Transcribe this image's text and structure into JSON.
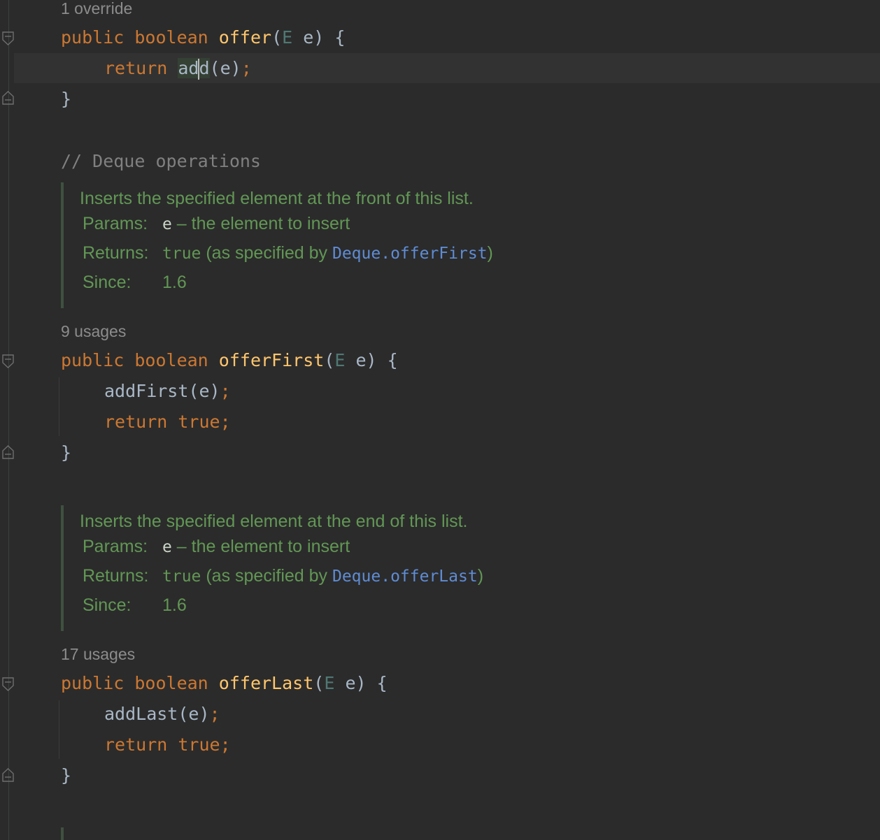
{
  "hints": {
    "override": "1 override",
    "usages_first": "9 usages",
    "usages_last": "17 usages"
  },
  "offer": {
    "kw_public": "public",
    "kw_boolean": "boolean",
    "name": "offer",
    "paren_open": "(",
    "type": "E",
    "param": " e) {",
    "kw_return": "return",
    "call_a": "ad",
    "call_b": "d",
    "call_args": "(e)",
    "semi": ";",
    "close": "}"
  },
  "comment": "// Deque operations",
  "doc_first": {
    "lead": "Inserts the specified element at the front of this list.",
    "params_label": "Params:",
    "params_name": "e",
    "params_desc": " – the element to insert",
    "returns_label": "Returns:",
    "returns_code": "true",
    "returns_text": " (as specified by ",
    "returns_link": "Deque.offerFirst",
    "returns_close": ")",
    "since_label": "Since:",
    "since_value": "1.6"
  },
  "offerFirst": {
    "kw_public": "public",
    "kw_boolean": "boolean",
    "name": "offerFirst",
    "paren_open": "(",
    "type": "E",
    "param": " e) {",
    "call": "addFirst(e)",
    "semi": ";",
    "kw_return": "return",
    "kw_true": "true",
    "close": "}"
  },
  "doc_last": {
    "lead": "Inserts the specified element at the end of this list.",
    "params_label": "Params:",
    "params_name": "e",
    "params_desc": " – the element to insert",
    "returns_label": "Returns:",
    "returns_code": "true",
    "returns_text": " (as specified by ",
    "returns_link": "Deque.offerLast",
    "returns_close": ")",
    "since_label": "Since:",
    "since_value": "1.6"
  },
  "offerLast": {
    "kw_public": "public",
    "kw_boolean": "boolean",
    "name": "offerLast",
    "paren_open": "(",
    "type": "E",
    "param": " e) {",
    "call": "addLast(e)",
    "semi": ";",
    "kw_return": "return",
    "kw_true": "true",
    "close": "}"
  },
  "colors": {
    "background": "#2b2b2b",
    "keyword": "#cc7832",
    "method": "#ffc66d",
    "doc": "#629755",
    "link": "#5f8cd4",
    "comment": "#808080"
  }
}
